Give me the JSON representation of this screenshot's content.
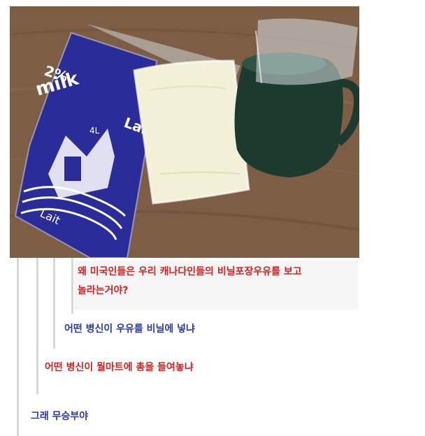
{
  "photo": {
    "alt_icon": "milk-bag-photo",
    "carton_text": {
      "brand_small": "2%",
      "word_milk": "milk",
      "word_lait": "Lait",
      "volume": "4L",
      "lait_bottom": "Lait"
    }
  },
  "comments": [
    {
      "line1": "왜 미국인들은 우리 캐나다인들의 비닐포장우유를 보고",
      "line2": "놀라는거야?",
      "color": "#d91f1f"
    },
    {
      "line1": "어떤 병신이 우유를 비닐에 넣냐",
      "color": "#2a3aa6"
    },
    {
      "line1": "어떤 병신이 월마트에 총을 들여놓냐",
      "color": "#d91f1f"
    },
    {
      "line1": "그래 무승부야",
      "color": "#2a3aa6"
    }
  ],
  "colors": {
    "red": "#d91f1f",
    "blue": "#2a3aa6",
    "reply_bar": "#d8d8d8"
  }
}
